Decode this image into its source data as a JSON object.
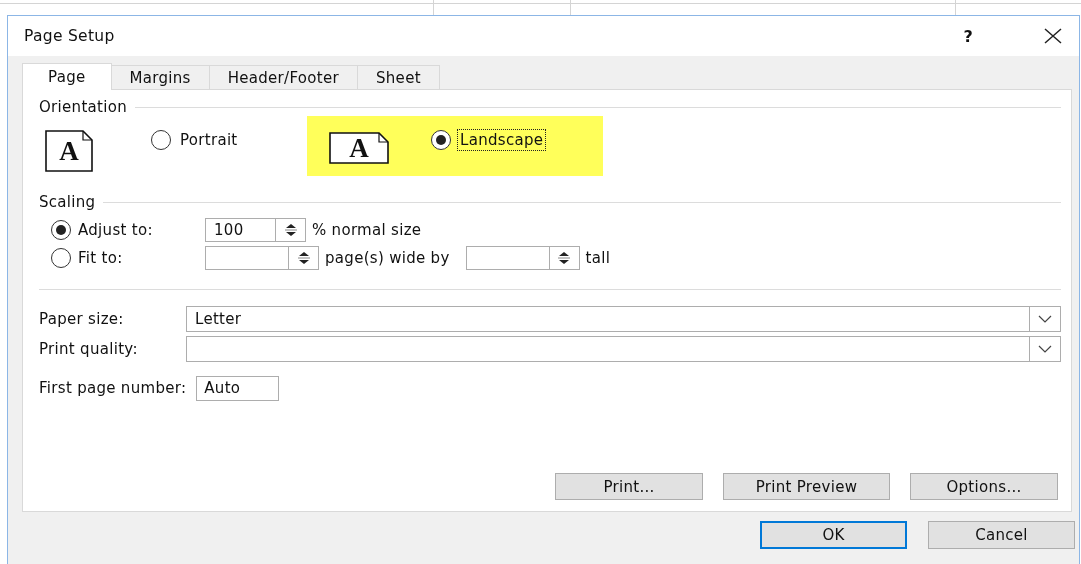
{
  "window": {
    "title": "Page Setup",
    "help": "?"
  },
  "tabs": [
    {
      "label": "Page",
      "selected": true
    },
    {
      "label": "Margins",
      "selected": false
    },
    {
      "label": "Header/Footer",
      "selected": false
    },
    {
      "label": "Sheet",
      "selected": false
    }
  ],
  "orientation": {
    "label": "Orientation",
    "options": [
      {
        "kind": "portrait",
        "label": "Portrait",
        "icon_letter": "A",
        "selected": false,
        "highlighted": false,
        "focused": false
      },
      {
        "kind": "landscape",
        "label": "Landscape",
        "icon_letter": "A",
        "selected": true,
        "highlighted": true,
        "focused": true
      }
    ]
  },
  "scaling": {
    "label": "Scaling",
    "options": [
      {
        "kind": "adjust",
        "label": "Adjust to:",
        "selected": true,
        "value": "100",
        "suffix": "% normal size"
      },
      {
        "kind": "fit",
        "label": "Fit to:",
        "selected": false,
        "wide_suffix": "page(s) wide by",
        "tall_suffix": "tall"
      }
    ]
  },
  "paper_size": {
    "label": "Paper size:",
    "value": "Letter"
  },
  "print_quality": {
    "label": "Print quality:"
  },
  "first_page_number": {
    "label": "First page number:",
    "value": "Auto"
  },
  "panel_buttons": [
    "Print...",
    "Print Preview",
    "Options..."
  ],
  "dialog_buttons": [
    {
      "label": "OK",
      "default": true
    },
    {
      "label": "Cancel",
      "default": false
    }
  ]
}
